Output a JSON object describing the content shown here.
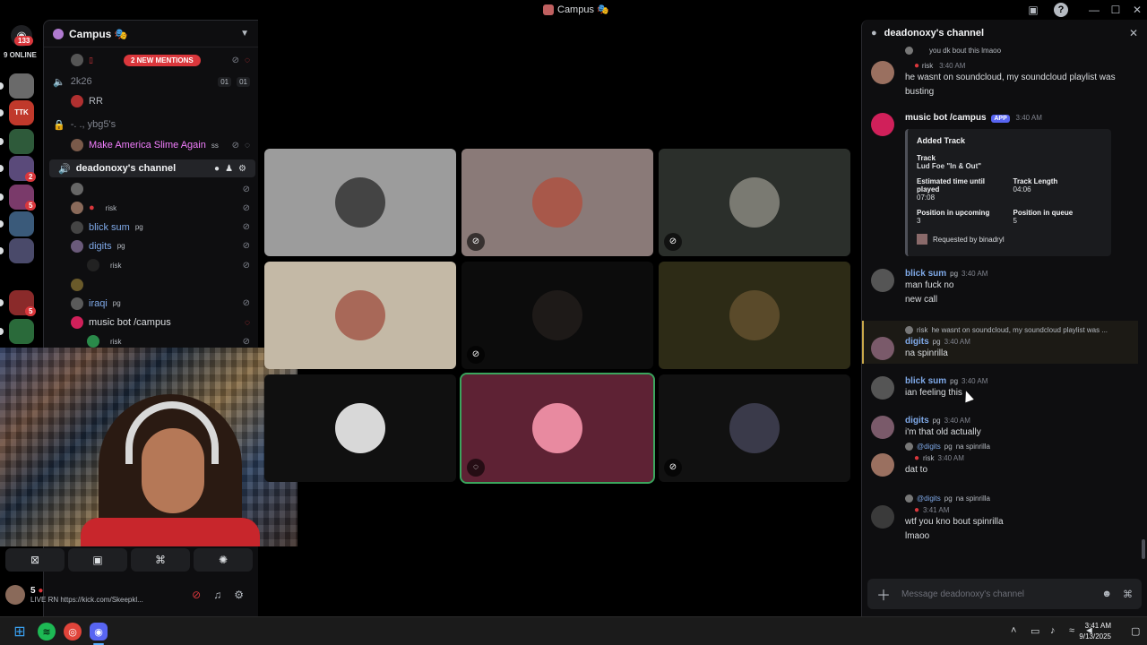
{
  "window": {
    "title": "Campus 🎭",
    "icons": {
      "inbox": "inbox-icon",
      "help": "?",
      "minimize": "—",
      "maximize": "☐",
      "close": "✕"
    }
  },
  "rail": {
    "home_badge": "133",
    "online_label": "9 ONLINE",
    "servers": [
      {
        "color": "#6a6a6a",
        "badge": ""
      },
      {
        "color": "#c0392b",
        "badge": "",
        "label": "TTK"
      },
      {
        "color": "#2e5a3a",
        "badge": ""
      },
      {
        "color": "#5a4a7a",
        "badge": "2"
      },
      {
        "color": "#7a3a6a",
        "badge": "5"
      },
      {
        "color": "#3a5a7a",
        "badge": ""
      },
      {
        "color": "#4a4a6a",
        "badge": ""
      },
      {
        "color": "#8a2a2a",
        "badge": "5"
      },
      {
        "color": "#2a6a3a",
        "badge": ""
      }
    ]
  },
  "sidebar": {
    "server_name": "Campus 🎭",
    "mentions_label": "2 NEW MENTIONS",
    "channels": [
      {
        "name": "2k26",
        "counts": [
          "01",
          "01"
        ]
      },
      {
        "name": "-. ., ybg5's"
      },
      {
        "name": "deadonoxy's channel"
      }
    ],
    "users_2k26": [
      {
        "name": "RR"
      }
    ],
    "users_ybg": [
      {
        "name": "Make America Slime Again",
        "tag": "ss"
      }
    ],
    "users_deadonoxy": [
      {
        "name": "",
        "tag": ""
      },
      {
        "name": "",
        "tag": "risk"
      },
      {
        "name": "blick sum",
        "tag": "pg"
      },
      {
        "name": "digits",
        "tag": "pg"
      },
      {
        "name": "",
        "tag": "risk"
      },
      {
        "name": "",
        "tag": ""
      },
      {
        "name": "iraqi",
        "tag": "pg"
      },
      {
        "name": "music bot /campus",
        "tag": ""
      },
      {
        "name": "",
        "tag": "risk"
      }
    ]
  },
  "user_panel": {
    "name": "5",
    "status": "LIVE RN https://kick.com/Skeepkl..."
  },
  "controls": {
    "camera": "camera-off-icon",
    "screen": "screen-share-icon",
    "activity": "gamepad-icon",
    "soundboard": "soundboard-icon"
  },
  "chat": {
    "channel_name": "deadonoxy's channel",
    "input_placeholder": "Message deadonoxy's channel",
    "messages": [
      {
        "reply_text": "you dk bout this lmaoo"
      },
      {
        "author": "",
        "tag": "risk",
        "time": "3:40 AM",
        "lines": [
          "he wasnt on soundcloud, my soundcloud playlist was",
          "busting"
        ]
      },
      {
        "author": "music bot /campus",
        "app": "APP",
        "time": "3:40 AM"
      },
      {
        "author": "blick sum",
        "tag": "pg",
        "time": "3:40 AM",
        "lines": [
          "man fuck no",
          "new call"
        ]
      },
      {
        "author": "digits",
        "tag": "pg",
        "time": "3:40 AM",
        "reply_tag": "risk",
        "reply_text": "he wasnt on soundcloud, my soundcloud playlist was ...",
        "lines": [
          "na spinrilla"
        ]
      },
      {
        "author": "blick sum",
        "tag": "pg",
        "time": "3:40 AM",
        "lines": [
          "ian feeling this"
        ]
      },
      {
        "author": "digits",
        "tag": "pg",
        "time": "3:40 AM",
        "lines": [
          "i'm that old actually"
        ]
      },
      {
        "author": "",
        "tag": "risk",
        "time": "3:40 AM",
        "reply_mention": "@digits",
        "reply_tag": "pg",
        "reply_text": "na spinrilla",
        "lines": [
          "dat to"
        ]
      },
      {
        "author": "",
        "time": "3:41 AM",
        "reply_mention": "@digits",
        "reply_tag": "pg",
        "reply_text": "na spinrilla",
        "lines": [
          "wtf you kno bout spinrilla",
          "lmaoo"
        ]
      }
    ],
    "embed": {
      "title": "Added Track",
      "track_label": "Track",
      "track_value": "Lud Foe \"In & Out\"",
      "est_label": "Estimated time until played",
      "est_value": "07:08",
      "len_label": "Track Length",
      "len_value": "04:06",
      "pos_up_label": "Position in upcoming",
      "pos_up_value": "3",
      "pos_q_label": "Position in queue",
      "pos_q_value": "5",
      "requested": "Requested by binadryl"
    }
  },
  "taskbar": {
    "time": "3:41 AM",
    "date": "9/13/2025"
  },
  "colors": {
    "accent": "#5865f2",
    "danger": "#da373c",
    "speaking": "#3ba55d"
  }
}
